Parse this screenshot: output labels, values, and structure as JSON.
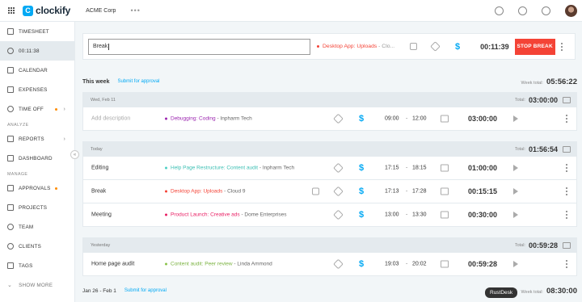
{
  "topbar": {
    "app_name": "clockify",
    "workspace": "ACME Corp",
    "more": "•••"
  },
  "sidebar": {
    "items": [
      {
        "label": "TIMESHEET"
      },
      {
        "label": "00:11:38"
      },
      {
        "label": "CALENDAR"
      },
      {
        "label": "EXPENSES"
      },
      {
        "label": "TIME OFF"
      }
    ],
    "analyze_header": "ANALYZE",
    "analyze_items": [
      {
        "label": "REPORTS"
      },
      {
        "label": "DASHBOARD"
      }
    ],
    "manage_header": "MANAGE",
    "manage_items": [
      {
        "label": "APPROVALS"
      },
      {
        "label": "PROJECTS"
      },
      {
        "label": "TEAM"
      },
      {
        "label": "CLIENTS"
      },
      {
        "label": "TAGS"
      }
    ],
    "show_more": "SHOW MORE"
  },
  "timer": {
    "description": "Break",
    "project": "Desktop App: Uploads",
    "client_trunc": "- Clo...",
    "project_color": "#f44336",
    "elapsed": "00:11:39",
    "stop_label": "STOP BREAK"
  },
  "this_week": {
    "title": "This week",
    "approval": "Submit for approval",
    "total_label": "Week total:",
    "total": "05:56:22"
  },
  "days": [
    {
      "label": "Wed, Feb 11",
      "total_label": "Total:",
      "total": "03:00:00",
      "entries": [
        {
          "desc": "Add description",
          "project": "Debugging: Coding",
          "client": "- Inpharm Tech",
          "color": "#9c27b0",
          "start": "09:00",
          "end": "12:00",
          "duration": "03:00:00"
        }
      ]
    },
    {
      "label": "Today",
      "total_label": "Total:",
      "total": "01:56:54",
      "entries": [
        {
          "desc": "Editing",
          "project": "Help Page Restructure: Content audit",
          "client": "- Inpharm Tech",
          "color": "#4dd0c4",
          "start": "17:15",
          "end": "18:15",
          "duration": "01:00:00"
        },
        {
          "desc": "Break",
          "project": "Desktop App: Uploads",
          "client": "- Cloud 9",
          "color": "#f44336",
          "start": "17:13",
          "end": "17:28",
          "duration": "00:15:15"
        },
        {
          "desc": "Meeting",
          "project": "Product Launch: Creative ads",
          "client": "- Dome Enterprises",
          "color": "#e91e63",
          "start": "13:00",
          "end": "13:30",
          "duration": "00:30:00"
        }
      ]
    },
    {
      "label": "Yesterday",
      "total_label": "Total:",
      "total": "00:59:28",
      "entries": [
        {
          "desc": "Home page audit",
          "project": "Content audit: Peer review",
          "client": "- Linda Ammond",
          "color": "#8bc34a",
          "start": "19:03",
          "end": "20:02",
          "duration": "00:59:28"
        }
      ]
    }
  ],
  "prev_week": {
    "title": "Jan 26 - Feb 1",
    "approval": "Submit for approval",
    "total_label": "Week total:",
    "total": "08:30:00"
  },
  "tooltip": "RustDesk",
  "accent": "#03a9f4",
  "danger": "#f44336"
}
